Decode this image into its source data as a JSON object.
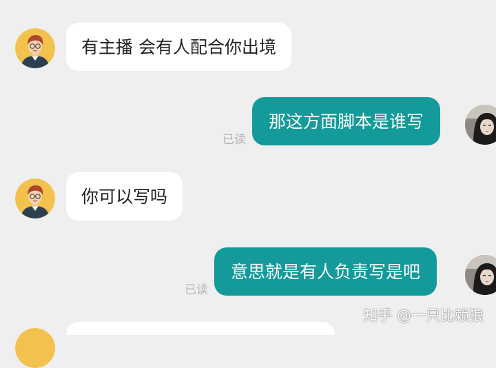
{
  "messages": [
    {
      "side": "left",
      "text": "有主播 会有人配合你出境"
    },
    {
      "side": "right",
      "text": "那这方面脚本是谁写",
      "status": "已读"
    },
    {
      "side": "left",
      "text": "你可以写吗"
    },
    {
      "side": "right",
      "text": "意思就是有人负责写是吧",
      "status": "已读"
    }
  ],
  "watermark": "知乎 @一只比赖狼",
  "colors": {
    "background": "#efefef",
    "incoming_bubble": "#ffffff",
    "outgoing_bubble": "#149a9a",
    "read_status": "#b3b3b3",
    "avatar_ring": "#f2c14e"
  },
  "icons": {
    "incoming_avatar": "cartoon-man-avatar-icon",
    "outgoing_avatar": "user-photo-avatar-icon"
  }
}
